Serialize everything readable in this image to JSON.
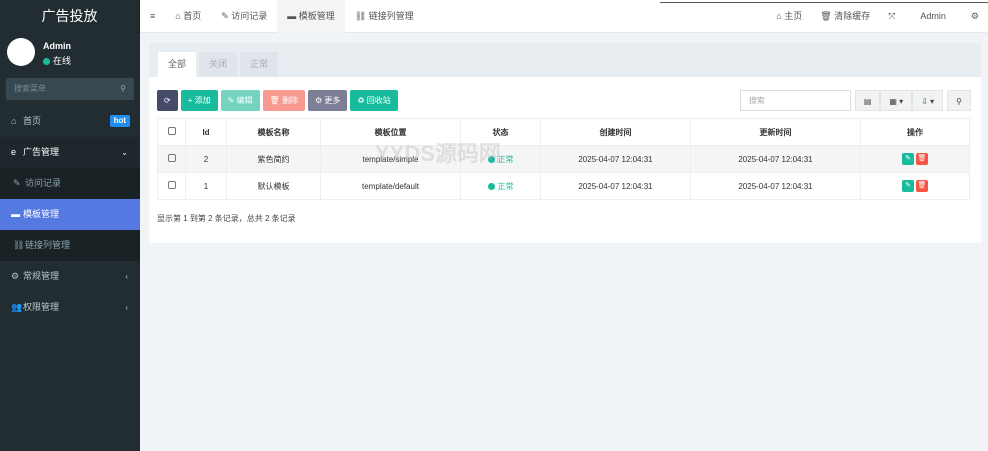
{
  "sidebar": {
    "logo": "广告投放",
    "user": "Admin",
    "status": "在线",
    "search_placeholder": "搜索菜单",
    "items": [
      {
        "label": "首页",
        "badge": "hot"
      },
      {
        "label": "广告管理"
      },
      {
        "label": "访问记录"
      },
      {
        "label": "模板管理"
      },
      {
        "label": "链接列管理"
      },
      {
        "label": "常规管理"
      },
      {
        "label": "权限管理"
      }
    ]
  },
  "header": {
    "tabs": [
      "首页",
      "访问记录",
      "模板管理",
      "链接列管理"
    ],
    "right": {
      "home": "主页",
      "clear": "清除缓存",
      "user": "Admin"
    }
  },
  "panel": {
    "tabs": [
      "全部",
      "关闭",
      "正常"
    ],
    "toolbar": {
      "add": "添加",
      "edit": "编辑",
      "delete": "删除",
      "more": "更多",
      "recycle": "回收站",
      "search_placeholder": "搜索"
    },
    "columns": [
      "Id",
      "模板名称",
      "模板位置",
      "状态",
      "创建时间",
      "更新时间",
      "操作"
    ],
    "rows": [
      {
        "id": "2",
        "name": "紫色简约",
        "path": "template/simple",
        "status": "正常",
        "created": "2025-04-07 12:04:31",
        "updated": "2025-04-07 12:04:31"
      },
      {
        "id": "1",
        "name": "默认模板",
        "path": "template/default",
        "status": "正常",
        "created": "2025-04-07 12:04:31",
        "updated": "2025-04-07 12:04:31"
      }
    ],
    "footer": "显示第 1 到第 2 条记录，总共 2 条记录"
  },
  "watermark": "YYDS源码网",
  "colors": {
    "accent": "#5479e0",
    "success": "#18bc9c",
    "danger": "#f75444",
    "sidebar": "#222d32"
  }
}
